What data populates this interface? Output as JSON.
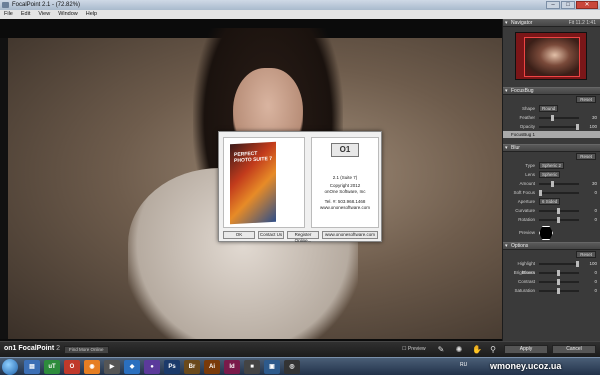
{
  "window": {
    "title": "FocalPoint 2.1 - (72.82%)",
    "min": "–",
    "max": "□",
    "close": "✕"
  },
  "menu": [
    "File",
    "Edit",
    "View",
    "Window",
    "Help"
  ],
  "dialog": {
    "box_title": "PERFECT PHOTO SUITE 7",
    "logo": "O1",
    "version": "2.1 (Suite 7)",
    "copyright": "Copyright 2012",
    "company": "onOne Software, Inc",
    "tel": "Tel. #: 503.968.1468",
    "url": "www.ononesoftware.com",
    "buttons": [
      "OK",
      "Contact Us",
      "Register Online...",
      "www.ononesoftware.com"
    ]
  },
  "panel": {
    "navigator": {
      "title": "Navigator",
      "zoom": "Fit 11.2 1:41"
    },
    "focusbug": {
      "title": "FocusBug",
      "reset": "Reset",
      "shape_label": "Shape",
      "shape_value": "Round",
      "rows": [
        {
          "label": "Feather",
          "value": 30
        },
        {
          "label": "Opacity",
          "value": 100
        }
      ],
      "selected_item": "FocusBug 1"
    },
    "blur": {
      "title": "Blur",
      "reset": "Reset",
      "type_label": "Type",
      "type_value": "Spheric 2",
      "lens_label": "Lens",
      "lens_value": "Spheric",
      "rows": [
        {
          "label": "Amount",
          "value": 30
        },
        {
          "label": "Soft Focus",
          "value": 0
        }
      ],
      "aperture_label": "Aperture",
      "aperture_value": "6 Sided",
      "rows2": [
        {
          "label": "Curvature",
          "value": 0
        },
        {
          "label": "Rotation",
          "value": 0
        }
      ],
      "preview_label": "Preview"
    },
    "options": {
      "title": "Options",
      "reset": "Reset",
      "rows": [
        {
          "label": "Highlight Bloom",
          "value": 100
        },
        {
          "label": "Brightness",
          "value": 0
        },
        {
          "label": "Contrast",
          "value": 0
        },
        {
          "label": "Saturation",
          "value": 0
        }
      ]
    }
  },
  "bottombar": {
    "brand": "on1 FocalPoint",
    "version": "2",
    "find_more": "Find More Online",
    "preview": "Preview",
    "apply": "Apply",
    "cancel": "Cancel"
  },
  "taskbar": {
    "tray": "RU",
    "icons": [
      "uT",
      "Ps",
      "Br",
      "Ai",
      "Id"
    ]
  },
  "watermark": "wmoney.ucoz.ua"
}
